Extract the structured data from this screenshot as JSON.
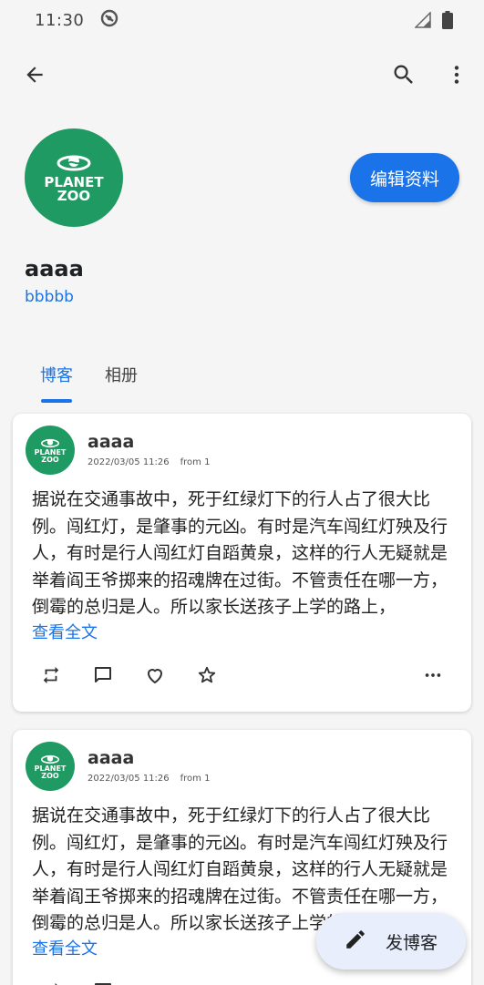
{
  "status_bar": {
    "time": "11:30"
  },
  "profile": {
    "name": "aaaa",
    "handle": "bbbbb",
    "edit_label": "编辑资料",
    "logo_line1": "PLANET",
    "logo_line2": "ZOO"
  },
  "tabs": [
    {
      "label": "博客",
      "active": true
    },
    {
      "label": "相册",
      "active": false
    }
  ],
  "posts": [
    {
      "author": "aaaa",
      "date": "2022/03/05 11:26",
      "source": "from 1",
      "text": "据说在交通事故中，死于红绿灯下的行人占了很大比例。闯红灯，是肇事的元凶。有时是汽车闯红灯殃及行人，有时是行人闯红灯自蹈黄泉，这样的行人无疑就是举着阎王爷掷来的招魂牌在过街。不管责任在哪一方，倒霉的总归是人。所以家长送孩子上学的路上，",
      "read_more": "查看全文"
    },
    {
      "author": "aaaa",
      "date": "2022/03/05 11:26",
      "source": "from 1",
      "text": "据说在交通事故中，死于红绿灯下的行人占了很大比例。闯红灯，是肇事的元凶。有时是汽车闯红灯殃及行人，有时是行人闯红灯自蹈黄泉，这样的行人无疑就是举着阎王爷掷来的招魂牌在过街。不管责任在哪一方，倒霉的总归是人。所以家长送孩子上学的路上，",
      "read_more": "查看全文"
    }
  ],
  "fab": {
    "label": "发博客"
  },
  "icons": {
    "back": "arrow-back-icon",
    "search": "search-icon",
    "more": "more-vert-icon",
    "repost": "repost-icon",
    "comment": "comment-icon",
    "like": "heart-icon",
    "favorite": "star-icon",
    "post_more": "more-horiz-icon",
    "fab": "pencil-icon"
  },
  "colors": {
    "accent": "#1a73e8",
    "avatar_bg": "#1f9a62",
    "fab_bg": "#e8eefb"
  }
}
